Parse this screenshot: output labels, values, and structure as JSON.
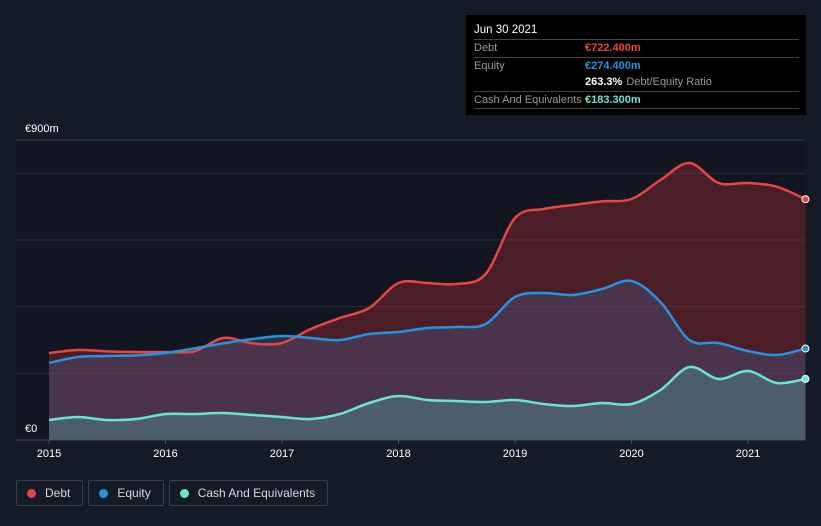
{
  "tooltip": {
    "date": "Jun 30 2021",
    "rows": [
      {
        "label": "Debt",
        "value": "€722.400m",
        "color": "#e84545"
      },
      {
        "label": "Equity",
        "value": "€274.400m",
        "color": "#2394df"
      },
      {
        "label": "Cash And Equivalents",
        "value": "€183.300m",
        "color": "#6ce5cf"
      }
    ],
    "ratio_value": "263.3%",
    "ratio_label": "Debt/Equity Ratio"
  },
  "chart_data": {
    "type": "area",
    "unit": "€m",
    "y_tick_labels": [
      "€0",
      "€900m"
    ],
    "ylim": [
      0,
      900
    ],
    "x_tick_labels": [
      "2015",
      "2016",
      "2017",
      "2018",
      "2019",
      "2020",
      "2021"
    ],
    "grid": true,
    "legend_placement": "bottom-left",
    "x": [
      "2015-01-01",
      "2015-04-01",
      "2015-07-01",
      "2015-10-01",
      "2016-01-01",
      "2016-04-01",
      "2016-07-01",
      "2016-10-01",
      "2017-01-01",
      "2017-04-01",
      "2017-07-01",
      "2017-10-01",
      "2018-01-01",
      "2018-04-01",
      "2018-07-01",
      "2018-10-01",
      "2019-01-01",
      "2019-04-01",
      "2019-07-01",
      "2019-10-01",
      "2020-01-01",
      "2020-04-01",
      "2020-07-01",
      "2020-10-01",
      "2021-01-01",
      "2021-04-01",
      "2021-06-30"
    ],
    "series": [
      {
        "name": "Debt",
        "color": "#e84545",
        "values": [
          261,
          270,
          266,
          264,
          264,
          266,
          306,
          290,
          291,
          333,
          366,
          396,
          471,
          471,
          468,
          498,
          666,
          693,
          705,
          716,
          723,
          780,
          831,
          771,
          771,
          760,
          722.4
        ]
      },
      {
        "name": "Equity",
        "color": "#2394df",
        "values": [
          231,
          249,
          252,
          254,
          261,
          275,
          290,
          303,
          312,
          306,
          300,
          318,
          324,
          336,
          339,
          348,
          429,
          441,
          435,
          453,
          477,
          414,
          300,
          291,
          267,
          255,
          274.4
        ]
      },
      {
        "name": "Cash And Equivalents",
        "color": "#6ce5cf",
        "values": [
          60,
          69,
          60,
          63,
          78,
          78,
          81,
          75,
          69,
          63,
          78,
          111,
          132,
          120,
          117,
          114,
          120,
          108,
          102,
          111,
          108,
          150,
          219,
          183,
          207,
          171,
          183.3
        ]
      }
    ]
  }
}
